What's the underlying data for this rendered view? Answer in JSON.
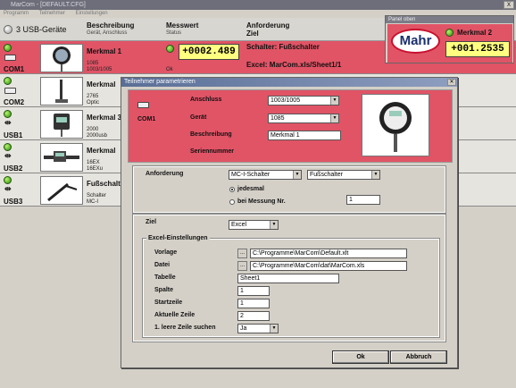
{
  "window": {
    "title": "MarCom - [DEFAULT.CFG]",
    "close": "X"
  },
  "menu": [
    "Programm",
    "Teilnehmer",
    "Einstellungen"
  ],
  "header": {
    "device_count_label": "3 USB-Geräte",
    "col_description": "Beschreibung",
    "col_description_sub": "Gerät, Anschluss",
    "col_value": "Messwert",
    "col_value_sub": "Status",
    "col_request": "Anforderung",
    "col_target": "Ziel"
  },
  "rows": [
    {
      "port": "COM1",
      "name": "Merkmal 1",
      "detail1": "1085",
      "detail2": "1003/1005",
      "value": "+0002.489",
      "status": "Ok",
      "request": "Schalter: Fußschalter",
      "target": "Excel: MarCom.xls/Sheet1/1"
    },
    {
      "port": "COM2",
      "name": "Merkmal",
      "detail1": "2765",
      "detail2": "Optic"
    },
    {
      "port": "USB1",
      "name": "Merkmal 3",
      "detail1": "2000",
      "detail2": "2000usb"
    },
    {
      "port": "USB2",
      "name": "Merkmal",
      "detail1": "16EX",
      "detail2": "16EXu"
    },
    {
      "port": "USB3",
      "name": "Fußschalter",
      "detail1": "Schalter",
      "detail2": "MC-I"
    }
  ],
  "mini_panel": {
    "title": "Panel oben",
    "brand": "Mahr",
    "name": "Merkmal 2",
    "value": "+001.2535"
  },
  "dialog": {
    "title": "Teilnehmer parametrieren",
    "port": "COM1",
    "anschluss_label": "Anschluss",
    "anschluss_value": "1003/1005",
    "geraet_label": "Gerät",
    "geraet_value": "1085",
    "beschreibung_label": "Beschreibung",
    "beschreibung_value": "Merkmal 1",
    "seriennummer_label": "Seriennummer",
    "anforderung_label": "Anforderung",
    "anforderung_type": "MC-I-Schalter",
    "anforderung_switch": "Fußschalter",
    "radio_each": "jedesmal",
    "radio_measure": "bei Messung Nr.",
    "measure_nr": "1",
    "ziel_label": "Ziel",
    "ziel_value": "Excel",
    "excel_group": "Excel-Einstellungen",
    "vorlage_label": "Vorlage",
    "vorlage_value": "C:\\Programme\\MarCom\\Default.xlt",
    "datei_label": "Datei",
    "datei_value": "C:\\Programme\\MarCom\\dat\\MarCom.xls",
    "tabelle_label": "Tabelle",
    "tabelle_value": "Sheet1",
    "spalte_label": "Spalte",
    "spalte_value": "1",
    "startzeile_label": "Startzeile",
    "startzeile_value": "1",
    "aktuelle_label": "Aktuelle Zeile",
    "aktuelle_value": "2",
    "leere_label": "1. leere Zeile suchen",
    "leere_value": "Ja",
    "ok": "Ok",
    "abbruch": "Abbruch",
    "browse": "..."
  },
  "colors": {
    "selected_row": "#e05466",
    "value_bg": "#ffff80",
    "mahr_red": "#c8102e"
  }
}
